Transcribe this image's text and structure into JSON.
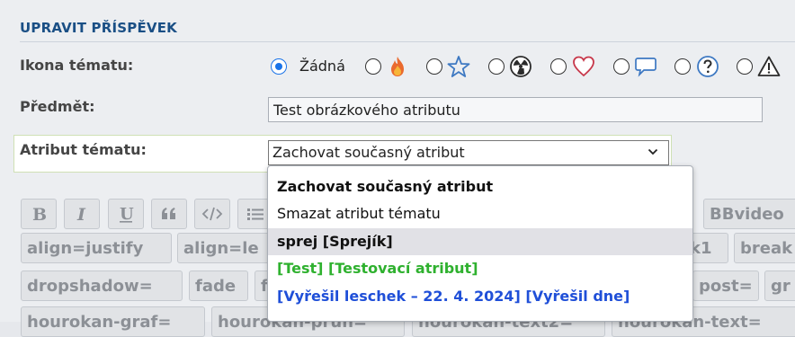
{
  "section": {
    "title": "UPRAVIT PŘÍSPĚVEK"
  },
  "labels": {
    "topic_icon": "Ikona tématu:",
    "subject": "Předmět:",
    "attribute": "Atribut tématu:"
  },
  "topic_icons": {
    "none_label": "Žádná",
    "selected": "none",
    "items": [
      "none",
      "fire-icon",
      "star-icon",
      "radioactive-icon",
      "heart-icon",
      "speech-bubble-icon",
      "question-icon",
      "warning-icon"
    ]
  },
  "subject": {
    "value": "Test obrázkového atributu"
  },
  "attribute_select": {
    "value": "Zachovat současný atribut",
    "options": [
      {
        "label": "Zachovat současný atribut",
        "color": "#111111",
        "bold": true
      },
      {
        "label": "Smazat atribut tématu",
        "color": "#111111",
        "bold": false
      },
      {
        "label": "sprej [Sprejík]",
        "color": "#111111",
        "bold": true,
        "highlighted": true
      },
      {
        "label": "[Test] [Testovací atribut]",
        "color": "#2fb12f",
        "bold": true
      },
      {
        "label": "[Vyřešil leschek – 22. 4. 2024] [Vyřešil dne]",
        "color": "#1f4fd8",
        "bold": true
      }
    ]
  },
  "bbcode_buttons": {
    "row1": [
      "BBvideo"
    ],
    "row2": [
      "align=justify",
      "align=le",
      "k1",
      "break"
    ],
    "row3": [
      "dropshadow=",
      "fade",
      "f",
      "post=",
      "gr"
    ],
    "row4": [
      "hourokan-graf=",
      "hourokan-prun=",
      "hourokan-text2=",
      "hourokan-text="
    ]
  },
  "colors": {
    "accent": "#1a4f85",
    "radio_checked": "#1a73e8",
    "highlight": "#e1e1e6"
  }
}
